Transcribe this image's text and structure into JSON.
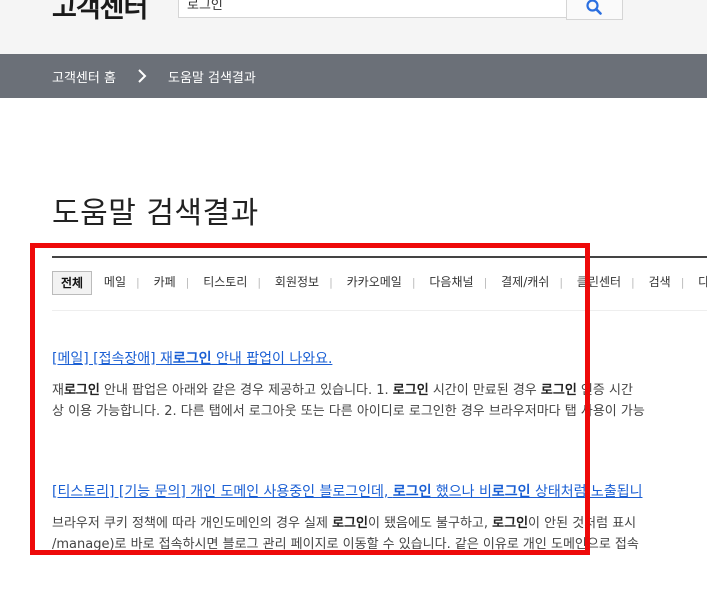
{
  "header": {
    "logo": "고객센터",
    "search": {
      "value": "로그인",
      "icon": "search-icon"
    }
  },
  "breadcrumb": {
    "home": "고객센터 홈",
    "current": "도움말 검색결과"
  },
  "page": {
    "title": "도움말 검색결과"
  },
  "tabs": [
    "전체",
    "메일",
    "카페",
    "티스토리",
    "회원정보",
    "카카오메일",
    "다음채널",
    "결제/캐쉬",
    "클린센터",
    "검색",
    "다음"
  ],
  "results": [
    {
      "title_pre": "[메일] [접속장애] 재",
      "title_kw": "로그인",
      "title_post": " 안내 팝업이 나와요.",
      "l1_a": "재",
      "l1_kw1": "로그인",
      "l1_b": " 안내 팝업은 아래와 같은 경우 제공하고 있습니다. 1. ",
      "l1_kw2": "로그인",
      "l1_c": " 시간이 만료된 경우 ",
      "l1_kw3": "로그인",
      "l1_d": " 인증 시간",
      "l2": "상 이용 가능합니다. 2. 다른 탭에서 로그아웃 또는 다른 아이디로 로그인한 경우 브라우저마다 탭 사용이 가능"
    },
    {
      "title_pre": "[티스토리] [기능 문의] 개인 도메인 사용중인 블로그인데, ",
      "title_kw1": "로그인",
      "title_mid": " 했으나 비",
      "title_kw2": "로그인",
      "title_post": " 상태처럼 노출됩니",
      "l1_a": "브라우저 쿠키 정책에 따라 개인도메인의 경우 실제 ",
      "l1_kw1": "로그인",
      "l1_b": "이 됐음에도 불구하고, ",
      "l1_kw2": "로그인",
      "l1_c": "이 안된 것처럼 표시",
      "l2": "/manage)로 바로 접속하시면 블로그 관리 페이지로 이동할 수 있습니다. 같은 이유로 개인 도메인으로 접속"
    }
  ],
  "colors": {
    "highlight": "#ee0a0a",
    "link": "#1a5fd4",
    "breadcrumb_bg": "#6b7078"
  }
}
